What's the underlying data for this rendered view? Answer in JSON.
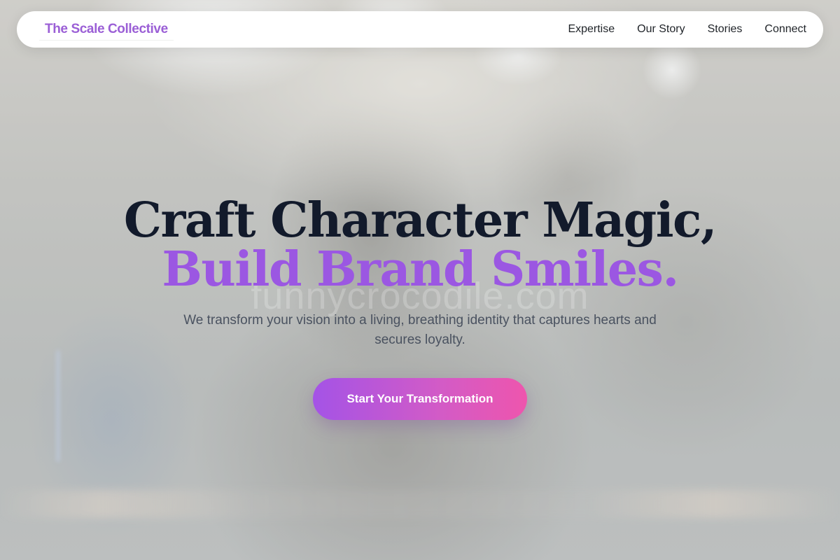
{
  "nav": {
    "brand": "The Scale Collective",
    "links": [
      "Expertise",
      "Our Story",
      "Stories",
      "Connect"
    ]
  },
  "hero": {
    "headline_line1": "Craft Character Magic,",
    "headline_line2": "Build Brand Smiles.",
    "subtitle": "We transform your vision into a living, breathing identity that captures hearts and secures loyalty.",
    "cta_label": "Start Your Transformation",
    "watermark": "funnycrocodile.com"
  },
  "colors": {
    "brand": "#9b5fd6",
    "headline_dark": "#121a2b",
    "headline_accent": "#9b57e2",
    "cta_gradient_start": "#a453e6",
    "cta_gradient_end": "#ee55ad",
    "navbar_bg": "#ffffff"
  }
}
